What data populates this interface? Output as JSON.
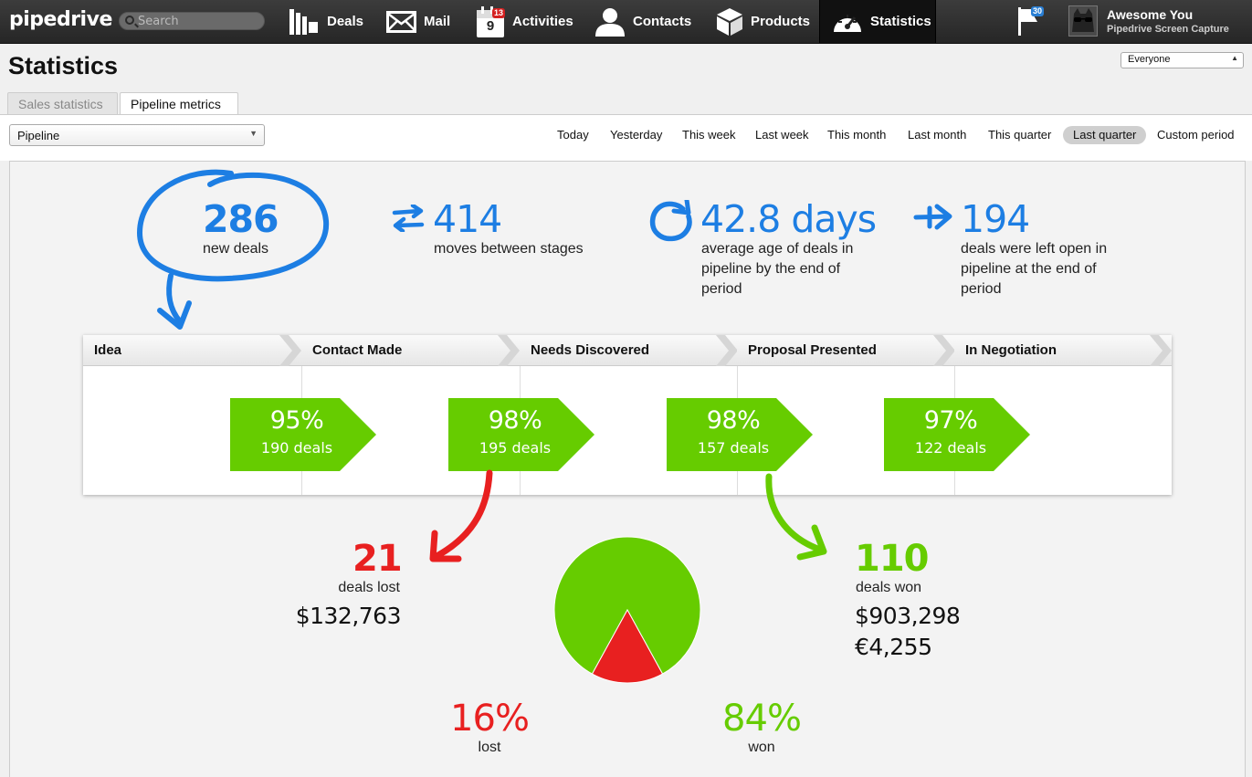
{
  "app": {
    "logo": "pipedrive",
    "search_placeholder": "Search"
  },
  "nav": [
    {
      "label": "Deals",
      "icon": "deals-icon"
    },
    {
      "label": "Mail",
      "icon": "mail-icon"
    },
    {
      "label": "Activities",
      "icon": "calendar-icon",
      "badge": "13",
      "calendar_day": "9"
    },
    {
      "label": "Contacts",
      "icon": "contacts-icon"
    },
    {
      "label": "Products",
      "icon": "products-icon"
    },
    {
      "label": "Statistics",
      "icon": "speedometer-icon",
      "active": true
    }
  ],
  "flag_badge": "30",
  "user": {
    "name": "Awesome You",
    "company": "Pipedrive Screen Capture"
  },
  "page": {
    "title": "Statistics",
    "filter_user": "Everyone",
    "tabs": [
      {
        "label": "Sales statistics",
        "active": false
      },
      {
        "label": "Pipeline metrics",
        "active": true
      }
    ],
    "pipeline_select": "Pipeline",
    "periods": [
      {
        "label": "Today",
        "selected": false
      },
      {
        "label": "Yesterday",
        "selected": false
      },
      {
        "label": "This week",
        "selected": false
      },
      {
        "label": "Last week",
        "selected": false
      },
      {
        "label": "This month",
        "selected": false
      },
      {
        "label": "Last month",
        "selected": false
      },
      {
        "label": "This quarter",
        "selected": false
      },
      {
        "label": "Last quarter",
        "selected": true
      },
      {
        "label": "Custom period",
        "selected": false
      }
    ]
  },
  "metrics": {
    "new_deals": {
      "value": "286",
      "label": "new deals"
    },
    "moves": {
      "value": "414",
      "label": "moves between stages"
    },
    "avg_age": {
      "value": "42.8 days",
      "label_1": "average age of deals in",
      "label_2": "pipeline by the end of",
      "label_3": "period"
    },
    "left_open": {
      "value": "194",
      "label_1": "deals were left open in",
      "label_2": "pipeline at the end of",
      "label_3": "period"
    }
  },
  "stages": [
    {
      "name": "Idea"
    },
    {
      "name": "Contact Made"
    },
    {
      "name": "Needs Discovered"
    },
    {
      "name": "Proposal Presented"
    },
    {
      "name": "In Negotiation"
    }
  ],
  "conversions": [
    {
      "percent": "95%",
      "deals": "190 deals"
    },
    {
      "percent": "98%",
      "deals": "195 deals"
    },
    {
      "percent": "98%",
      "deals": "157 deals"
    },
    {
      "percent": "97%",
      "deals": "122 deals"
    }
  ],
  "lost": {
    "count": "21",
    "label": "deals lost",
    "amount": "$132,763",
    "percent": "16%",
    "percent_label": "lost"
  },
  "won": {
    "count": "110",
    "label": "deals won",
    "amount_usd": "$903,298",
    "amount_eur": "€4,255",
    "percent": "84%",
    "percent_label": "won"
  },
  "colors": {
    "blue": "#1d7ee3",
    "green": "#66cc00",
    "red": "#e82020",
    "nav_bg": "#2e2e2e"
  },
  "chart_data": {
    "type": "pie",
    "categories": [
      "won",
      "lost"
    ],
    "values": [
      84,
      16
    ]
  }
}
